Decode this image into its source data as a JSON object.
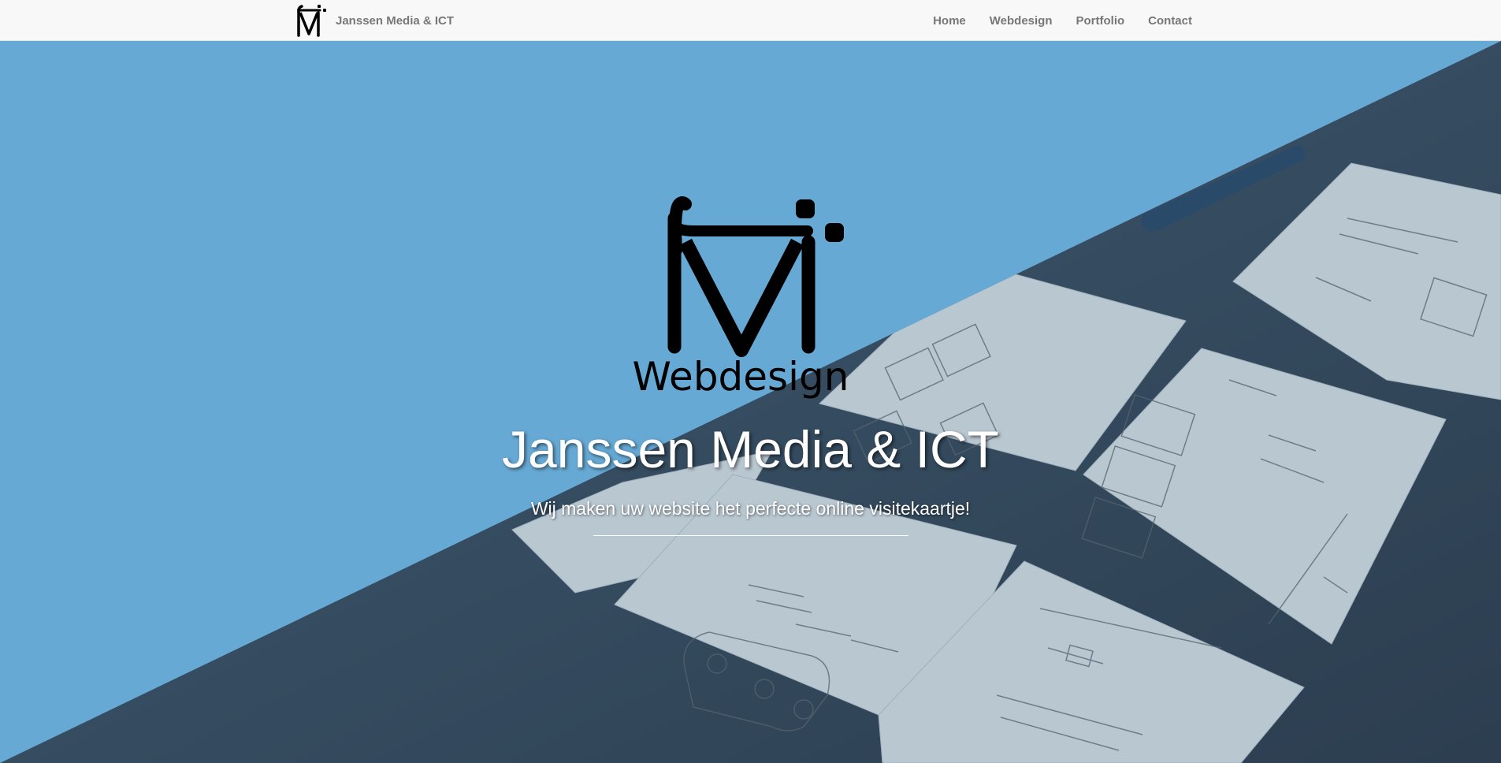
{
  "navbar": {
    "brand_text": "Janssen Media & ICT",
    "brand_logo_icon": "jm-monogram-logo",
    "links": [
      {
        "label": "Home"
      },
      {
        "label": "Webdesign"
      },
      {
        "label": "Portfolio"
      },
      {
        "label": "Contact"
      }
    ]
  },
  "hero": {
    "logo_icon": "jm-monogram-webdesign-logo",
    "logo_word": "Webdesign",
    "title": "Janssen Media & ICT",
    "subtitle": "Wij maken uw website het perfecte online visitekaartje!",
    "background_photo": "wireframe-sketches-photo"
  },
  "colors": {
    "navbar_bg": "#f8f8f8",
    "nav_text": "#777777",
    "hero_blue": "#66a9d4",
    "photo_dark": "#34495c",
    "hero_text": "#ffffff"
  }
}
